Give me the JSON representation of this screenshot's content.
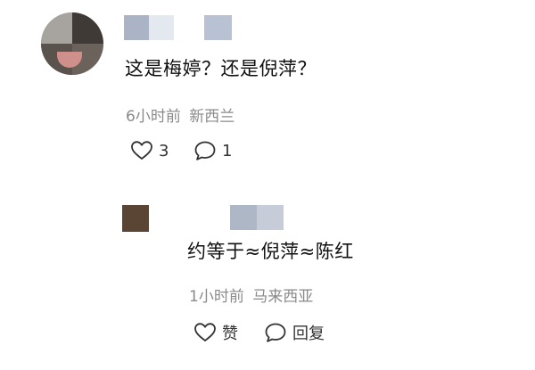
{
  "comment": {
    "text": "这是梅婷？还是倪萍？",
    "time": "6小时前",
    "location": "新西兰",
    "like_count": "3",
    "reply_count": "1"
  },
  "reply": {
    "text": "约等于≈倪萍≈陈红",
    "time": "1小时前",
    "location": "马来西亚",
    "like_label": "赞",
    "reply_label": "回复"
  },
  "icons": {
    "heart": "heart-outline-icon",
    "bubble": "comment-bubble-icon"
  },
  "colors": {
    "text_primary": "#111111",
    "text_meta": "#8a8a8a",
    "icon_stroke": "#333333"
  }
}
